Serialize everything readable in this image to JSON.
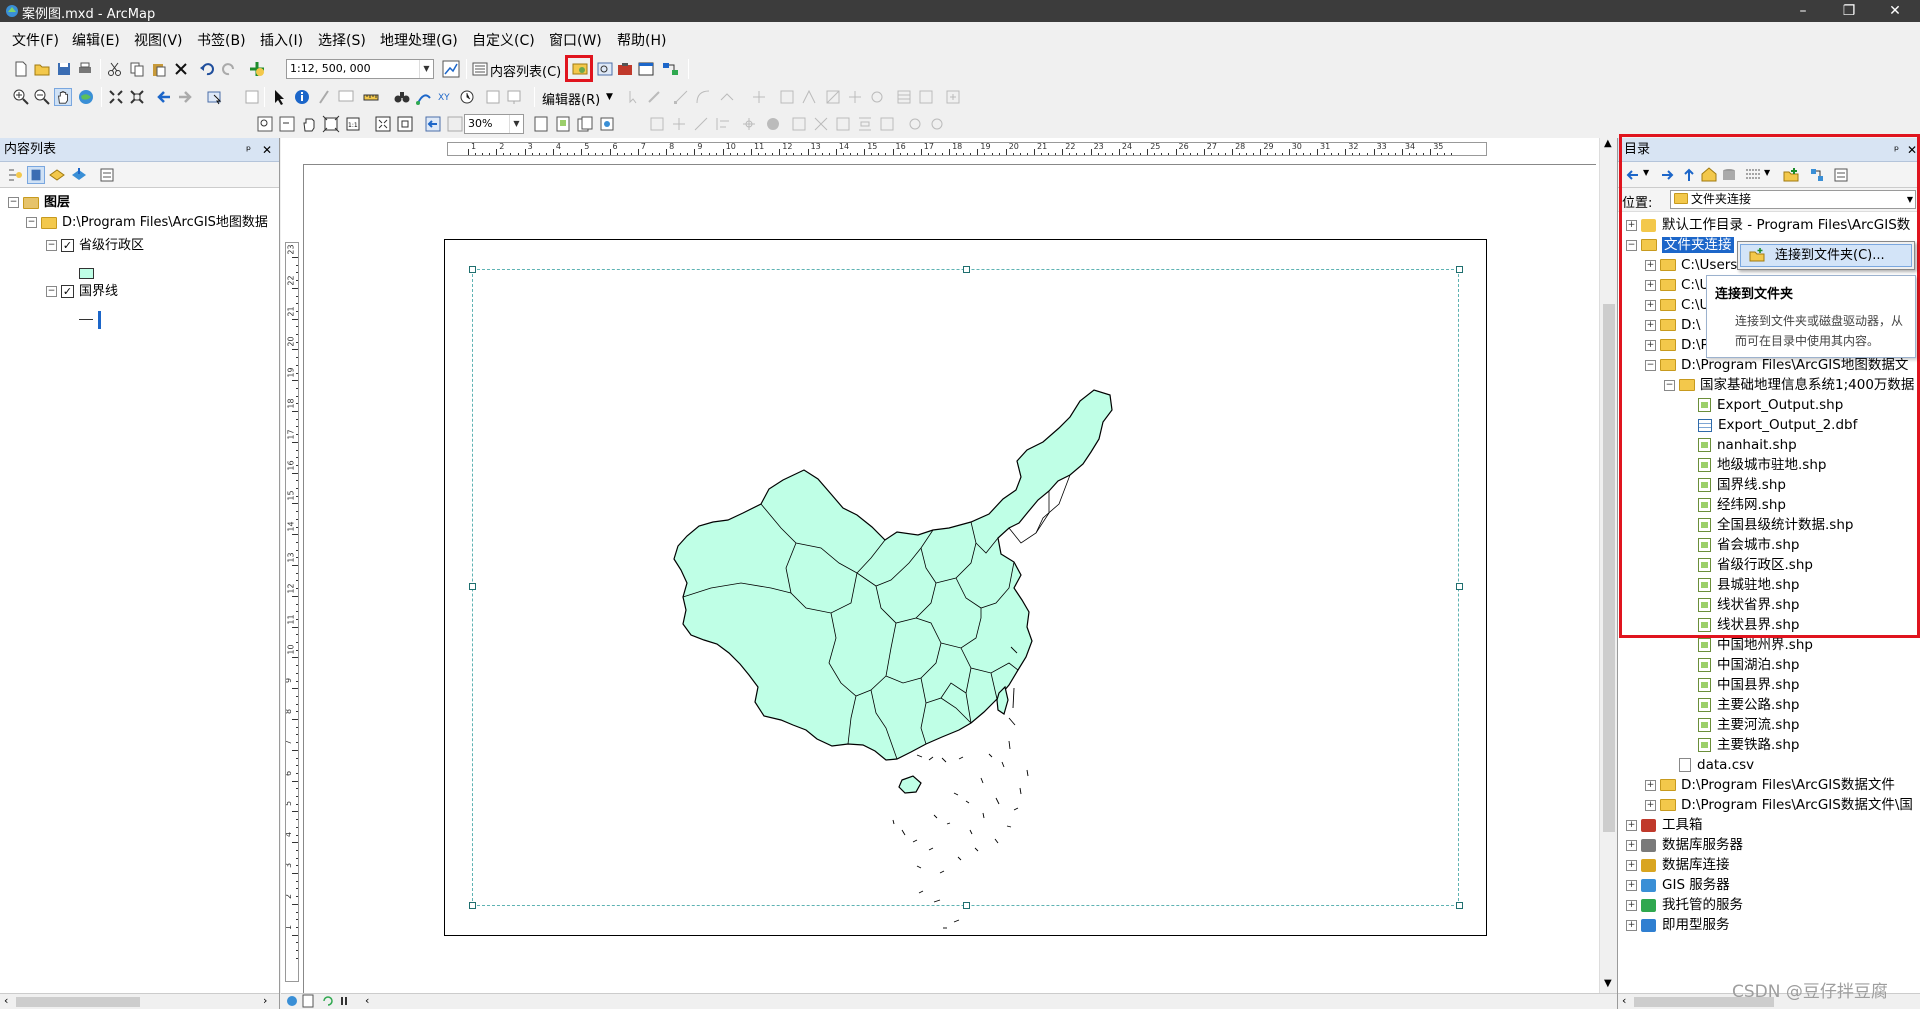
{
  "window": {
    "title": "案例图.mxd - ArcMap",
    "minimize": "–",
    "restore": "❐",
    "close": "✕"
  },
  "menu": [
    "文件(F)",
    "编辑(E)",
    "视图(V)",
    "书签(B)",
    "插入(I)",
    "选择(S)",
    "地理处理(G)",
    "自定义(C)",
    "窗口(W)",
    "帮助(H)"
  ],
  "toolbar": {
    "scale_value": "1:12, 500, 000",
    "toc_button_label": "内容列表(C)",
    "editor_label": "编辑器(R)",
    "zoom_value": "30%"
  },
  "toc": {
    "title": "内容列表",
    "pin": "ᵖ",
    "close": "✕",
    "root_label": "图层",
    "frame_label": "D:\\Program Files\\ArcGIS地图数据",
    "layers": [
      {
        "label": "省级行政区",
        "checked": true,
        "symbol": "fill"
      },
      {
        "label": "国界线",
        "checked": true,
        "symbol": "line"
      }
    ]
  },
  "ruler": {
    "top_labels": [
      "1",
      "2",
      "3",
      "4",
      "5",
      "6",
      "7",
      "8",
      "9",
      "10",
      "11",
      "12",
      "13",
      "14",
      "15",
      "16",
      "17",
      "18",
      "19",
      "20",
      "21",
      "22",
      "23",
      "24",
      "25",
      "26",
      "27",
      "28",
      "29",
      "30",
      "31",
      "32",
      "33",
      "34",
      "35"
    ],
    "left_labels": [
      "23",
      "22",
      "21",
      "20",
      "19",
      "18",
      "17",
      "16",
      "15",
      "14",
      "13",
      "12",
      "11",
      "10",
      "9",
      "8",
      "7",
      "6",
      "5",
      "4",
      "3",
      "2",
      "1"
    ]
  },
  "map": {
    "fill_color": "#bfffe6",
    "stroke_color": "#000000"
  },
  "catalog": {
    "title": "目录",
    "pin": "ᵖ",
    "close": "✕",
    "location_label": "位置:",
    "location_value": "文件夹连接",
    "rows": [
      {
        "label": "默认工作目录 - Program Files\\ArcGIS数",
        "level": 0,
        "expander": "+",
        "icon": "folder-home"
      },
      {
        "label": "文件夹连接",
        "level": 0,
        "expander": "−",
        "icon": "folder",
        "selected": true
      },
      {
        "label": "C:\\Users",
        "level": 1,
        "expander": "+",
        "icon": "folder"
      },
      {
        "label": "C:\\U",
        "level": 1,
        "expander": "+",
        "icon": "folder"
      },
      {
        "label": "C:\\U",
        "level": 1,
        "expander": "+",
        "icon": "folder"
      },
      {
        "label": "D:\\",
        "level": 1,
        "expander": "+",
        "icon": "folder"
      },
      {
        "label": "D:\\P",
        "level": 1,
        "expander": "+",
        "icon": "folder"
      },
      {
        "label": "D:\\Program Files\\ArcGIS地图数据文",
        "level": 1,
        "expander": "−",
        "icon": "folder"
      },
      {
        "label": "国家基础地理信息系统1;400万数据",
        "level": 2,
        "expander": "−",
        "icon": "folder"
      },
      {
        "label": "Export_Output.shp",
        "level": 3,
        "icon": "shp"
      },
      {
        "label": "Export_Output_2.dbf",
        "level": 3,
        "icon": "table"
      },
      {
        "label": "nanhait.shp",
        "level": 3,
        "icon": "shp"
      },
      {
        "label": "地级城市驻地.shp",
        "level": 3,
        "icon": "shp"
      },
      {
        "label": "国界线.shp",
        "level": 3,
        "icon": "shp"
      },
      {
        "label": "经纬网.shp",
        "level": 3,
        "icon": "shp"
      },
      {
        "label": "全国县级统计数据.shp",
        "level": 3,
        "icon": "shp"
      },
      {
        "label": "省会城市.shp",
        "level": 3,
        "icon": "shp"
      },
      {
        "label": "省级行政区.shp",
        "level": 3,
        "icon": "shp"
      },
      {
        "label": "县城驻地.shp",
        "level": 3,
        "icon": "shp"
      },
      {
        "label": "线状省界.shp",
        "level": 3,
        "icon": "shp"
      },
      {
        "label": "线状县界.shp",
        "level": 3,
        "icon": "shp"
      },
      {
        "label": "中国地州界.shp",
        "level": 3,
        "icon": "shp"
      },
      {
        "label": "中国湖泊.shp",
        "level": 3,
        "icon": "shp"
      },
      {
        "label": "中国县界.shp",
        "level": 3,
        "icon": "shp"
      },
      {
        "label": "主要公路.shp",
        "level": 3,
        "icon": "shp"
      },
      {
        "label": "主要河流.shp",
        "level": 3,
        "icon": "shp"
      },
      {
        "label": "主要铁路.shp",
        "level": 3,
        "icon": "shp"
      },
      {
        "label": "data.csv",
        "level": 2,
        "icon": "doc"
      },
      {
        "label": "D:\\Program Files\\ArcGIS数据文件",
        "level": 1,
        "expander": "+",
        "icon": "folder"
      },
      {
        "label": "D:\\Program Files\\ArcGIS数据文件\\国",
        "level": 1,
        "expander": "+",
        "icon": "folder"
      },
      {
        "label": "工具箱",
        "level": 0,
        "expander": "+",
        "icon": "toolbox"
      },
      {
        "label": "数据库服务器",
        "level": 0,
        "expander": "+",
        "icon": "db-server"
      },
      {
        "label": "数据库连接",
        "level": 0,
        "expander": "+",
        "icon": "db-conn"
      },
      {
        "label": "GIS 服务器",
        "level": 0,
        "expander": "+",
        "icon": "gis-server"
      },
      {
        "label": "我托管的服务",
        "level": 0,
        "expander": "+",
        "icon": "hosted"
      },
      {
        "label": "即用型服务",
        "level": 0,
        "expander": "+",
        "icon": "ready"
      }
    ],
    "context_menu_item": "连接到文件夹(C)...",
    "tooltip_title": "连接到文件夹",
    "tooltip_desc": "连接到文件夹或磁盘驱动器，从而可在目录中使用其内容。"
  },
  "watermark": "CSDN @豆仔拌豆腐"
}
